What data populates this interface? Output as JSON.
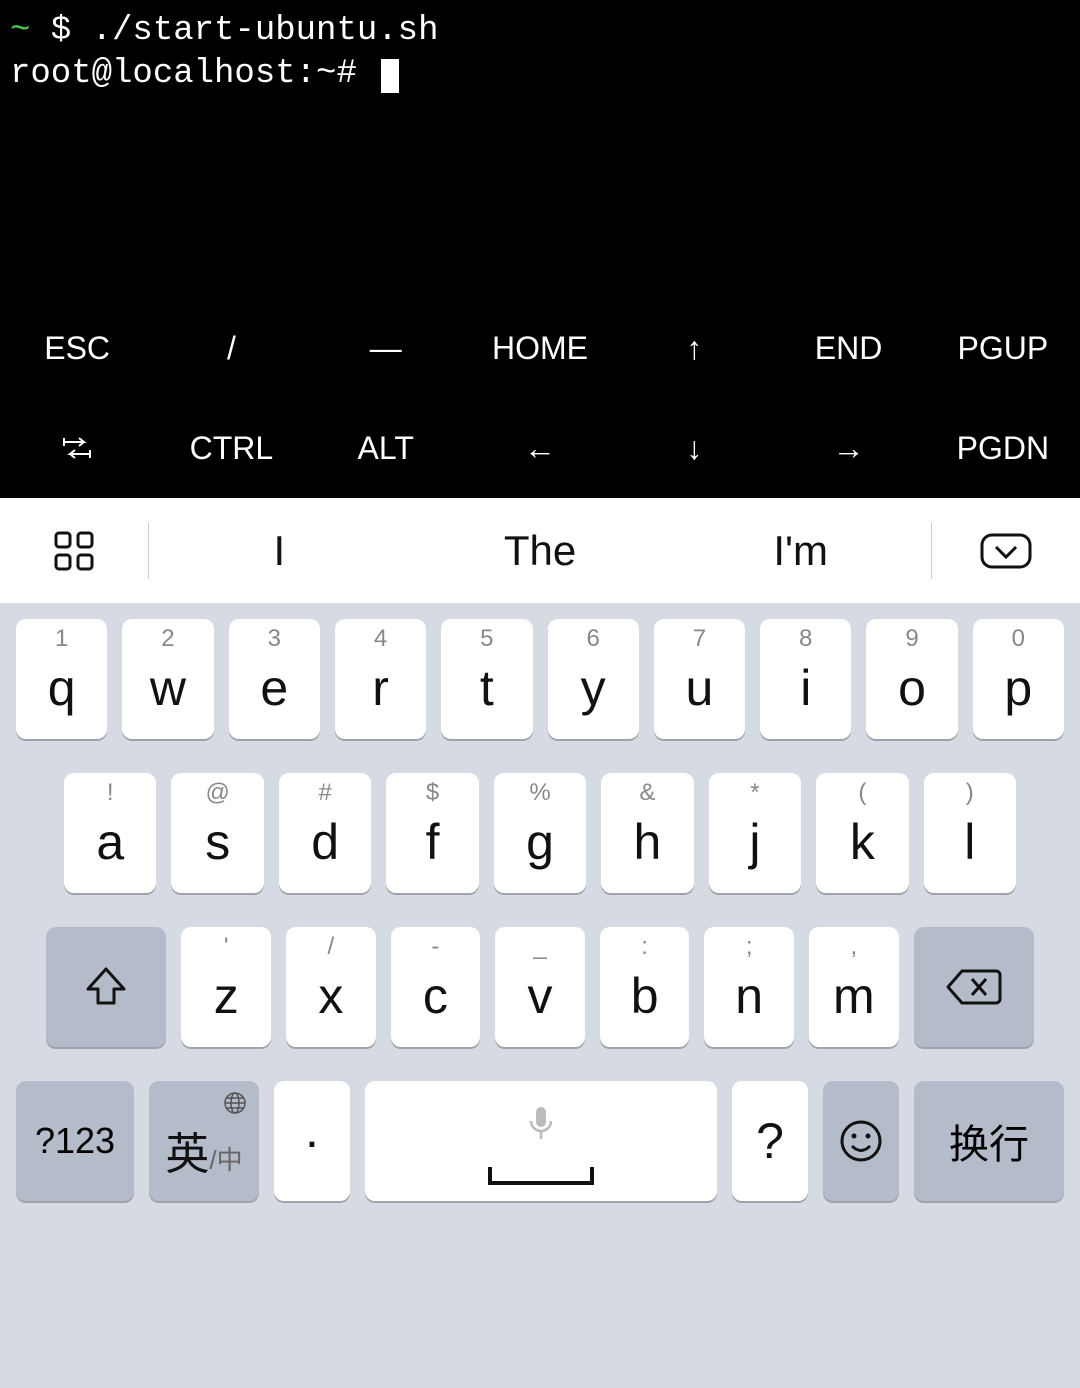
{
  "terminal": {
    "line1_tilde": "~",
    "line1_rest": " $ ./start-ubuntu.sh",
    "line2": "root@localhost:~# "
  },
  "extra_keys": {
    "row1": [
      "ESC",
      "/",
      "—",
      "HOME",
      "↑",
      "END",
      "PGUP"
    ],
    "row2_tab": "⇄",
    "row2": [
      "CTRL",
      "ALT",
      "←",
      "↓",
      "→",
      "PGDN"
    ]
  },
  "suggestions": [
    "I",
    "The",
    "I'm"
  ],
  "keyboard": {
    "row1": [
      {
        "hint": "1",
        "main": "q"
      },
      {
        "hint": "2",
        "main": "w"
      },
      {
        "hint": "3",
        "main": "e"
      },
      {
        "hint": "4",
        "main": "r"
      },
      {
        "hint": "5",
        "main": "t"
      },
      {
        "hint": "6",
        "main": "y"
      },
      {
        "hint": "7",
        "main": "u"
      },
      {
        "hint": "8",
        "main": "i"
      },
      {
        "hint": "9",
        "main": "o"
      },
      {
        "hint": "0",
        "main": "p"
      }
    ],
    "row2": [
      {
        "hint": "!",
        "main": "a"
      },
      {
        "hint": "@",
        "main": "s"
      },
      {
        "hint": "#",
        "main": "d"
      },
      {
        "hint": "$",
        "main": "f"
      },
      {
        "hint": "%",
        "main": "g"
      },
      {
        "hint": "&",
        "main": "h"
      },
      {
        "hint": "*",
        "main": "j"
      },
      {
        "hint": "(",
        "main": "k"
      },
      {
        "hint": ")",
        "main": "l"
      }
    ],
    "row3": [
      {
        "hint": "'",
        "main": "z"
      },
      {
        "hint": "/",
        "main": "x"
      },
      {
        "hint": "-",
        "main": "c"
      },
      {
        "hint": "_",
        "main": "v"
      },
      {
        "hint": ":",
        "main": "b"
      },
      {
        "hint": ";",
        "main": "n"
      },
      {
        "hint": ",",
        "main": "m"
      }
    ],
    "symbols_label": "?123",
    "lang_primary": "英",
    "lang_secondary": "/中",
    "period": "·",
    "question": "?",
    "enter": "换行"
  }
}
